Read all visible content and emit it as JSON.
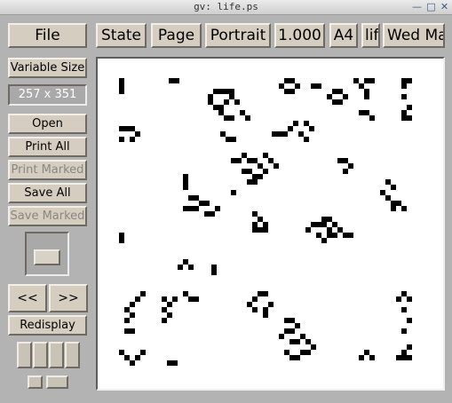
{
  "window": {
    "title": "gv: life.ps",
    "controls": [
      "minimize-icon",
      "maximize-icon",
      "close-icon"
    ]
  },
  "toolbar": {
    "file": "File",
    "state": "State",
    "page": "Page",
    "orientation": "Portrait",
    "scale": "1.000",
    "media": "A4",
    "truncated_item": "lif",
    "date": "Wed Ma"
  },
  "sidebar": {
    "size_mode": "Variable Size",
    "page_size": "257 x 351",
    "open": "Open",
    "print_all": "Print All",
    "print_marked": "Print Marked",
    "save_all": "Save All",
    "save_marked": "Save Marked",
    "prev": "<<",
    "next": ">>",
    "redisplay": "Redisplay"
  },
  "colors": {
    "background": "#b3b3b3",
    "button": "#d5cdc0",
    "page": "#ffffff",
    "ink": "#000000"
  },
  "document": {
    "content": "Conway's Game of Life cell pattern (black squares on white page)"
  }
}
